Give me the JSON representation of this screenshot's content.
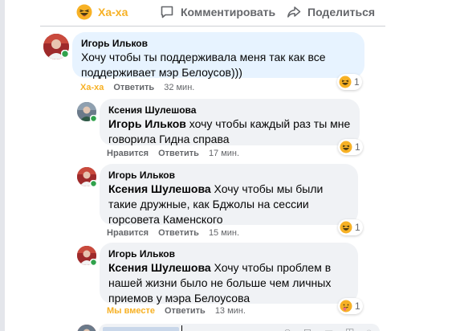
{
  "action_bar": {
    "haha_label": "Ха-ха",
    "comment_label": "Комментировать",
    "share_label": "Поделиться"
  },
  "colors": {
    "haha": "#f7b125",
    "secondary_text": "#65676b",
    "bubble_bg": "#f0f2f5",
    "highlight_bg": "#e7f3ff",
    "online_dot": "#31a24c"
  },
  "comments": [
    {
      "author": "Игорь Ильков",
      "mention": "",
      "text": "Хочу чтобы ты поддерживала меня так как все поддерживает мэр Белоусов)))",
      "action": "Ха-ха",
      "reply": "Ответить",
      "time": "32 мин.",
      "reaction_count": "1",
      "avatar_icon": "user-photo-icon",
      "reaction_icon": "haha-emoji-icon"
    },
    {
      "author": "Ксения Шулешова",
      "mention": "Игорь Ильков",
      "text": "хочу чтобы каждый раз ты мне говорила Гидна справа",
      "action": "Нравится",
      "reply": "Ответить",
      "time": "17 мин.",
      "reaction_count": "1",
      "avatar_icon": "user-photo-icon",
      "reaction_icon": "haha-emoji-icon"
    },
    {
      "author": "Игорь Ильков",
      "mention": "Ксения Шулешова",
      "text": "Хочу чтобы мы были такие дружные, как Бджолы на сессии горсовета Каменского",
      "action": "Нравится",
      "reply": "Ответить",
      "time": "15 мин.",
      "reaction_count": "1",
      "avatar_icon": "user-photo-icon",
      "reaction_icon": "haha-emoji-icon"
    },
    {
      "author": "Игорь Ильков",
      "mention": "Ксения Шулешова",
      "text": "Хочу чтобы проблем в нашей жизни было не больше чем личных приемов у мэра Белоусова",
      "action": "Мы вместе",
      "reply": "Ответить",
      "time": "13 мин.",
      "reaction_count": "1",
      "avatar_icon": "user-photo-icon",
      "reaction_icon": "care-emoji-icon"
    }
  ]
}
